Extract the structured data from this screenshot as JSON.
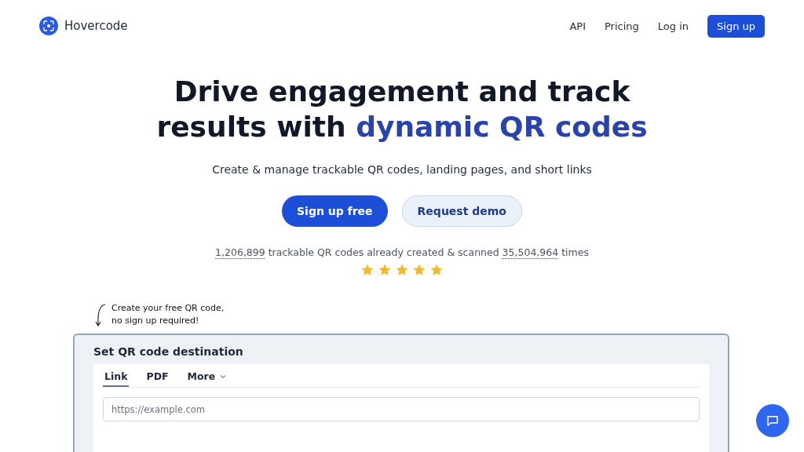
{
  "nav": {
    "brand": "Hovercode",
    "links": [
      "API",
      "Pricing",
      "Log in"
    ],
    "signup": "Sign up"
  },
  "hero": {
    "headline": "Drive engagement and track results with ",
    "highlight": "dynamic QR codes",
    "subtitle": "Create & manage trackable QR codes, landing pages, and short links",
    "primary": "Sign up free",
    "secondary": "Request demo"
  },
  "stats": {
    "created": "1,206,899",
    "middle": " trackable QR codes already created & scanned ",
    "scanned": "35,504,964",
    "end": " times",
    "stars": 5
  },
  "callout": [
    "Create your free QR code,",
    "no sign up required!"
  ],
  "card": {
    "title": "Set QR code destination",
    "tabs": [
      {
        "label": "Link",
        "selected": true,
        "dropdown": false
      },
      {
        "label": "PDF",
        "selected": false,
        "dropdown": false
      },
      {
        "label": "More",
        "selected": false,
        "dropdown": true
      }
    ],
    "input": {
      "placeholder": "https://example.com"
    }
  }
}
